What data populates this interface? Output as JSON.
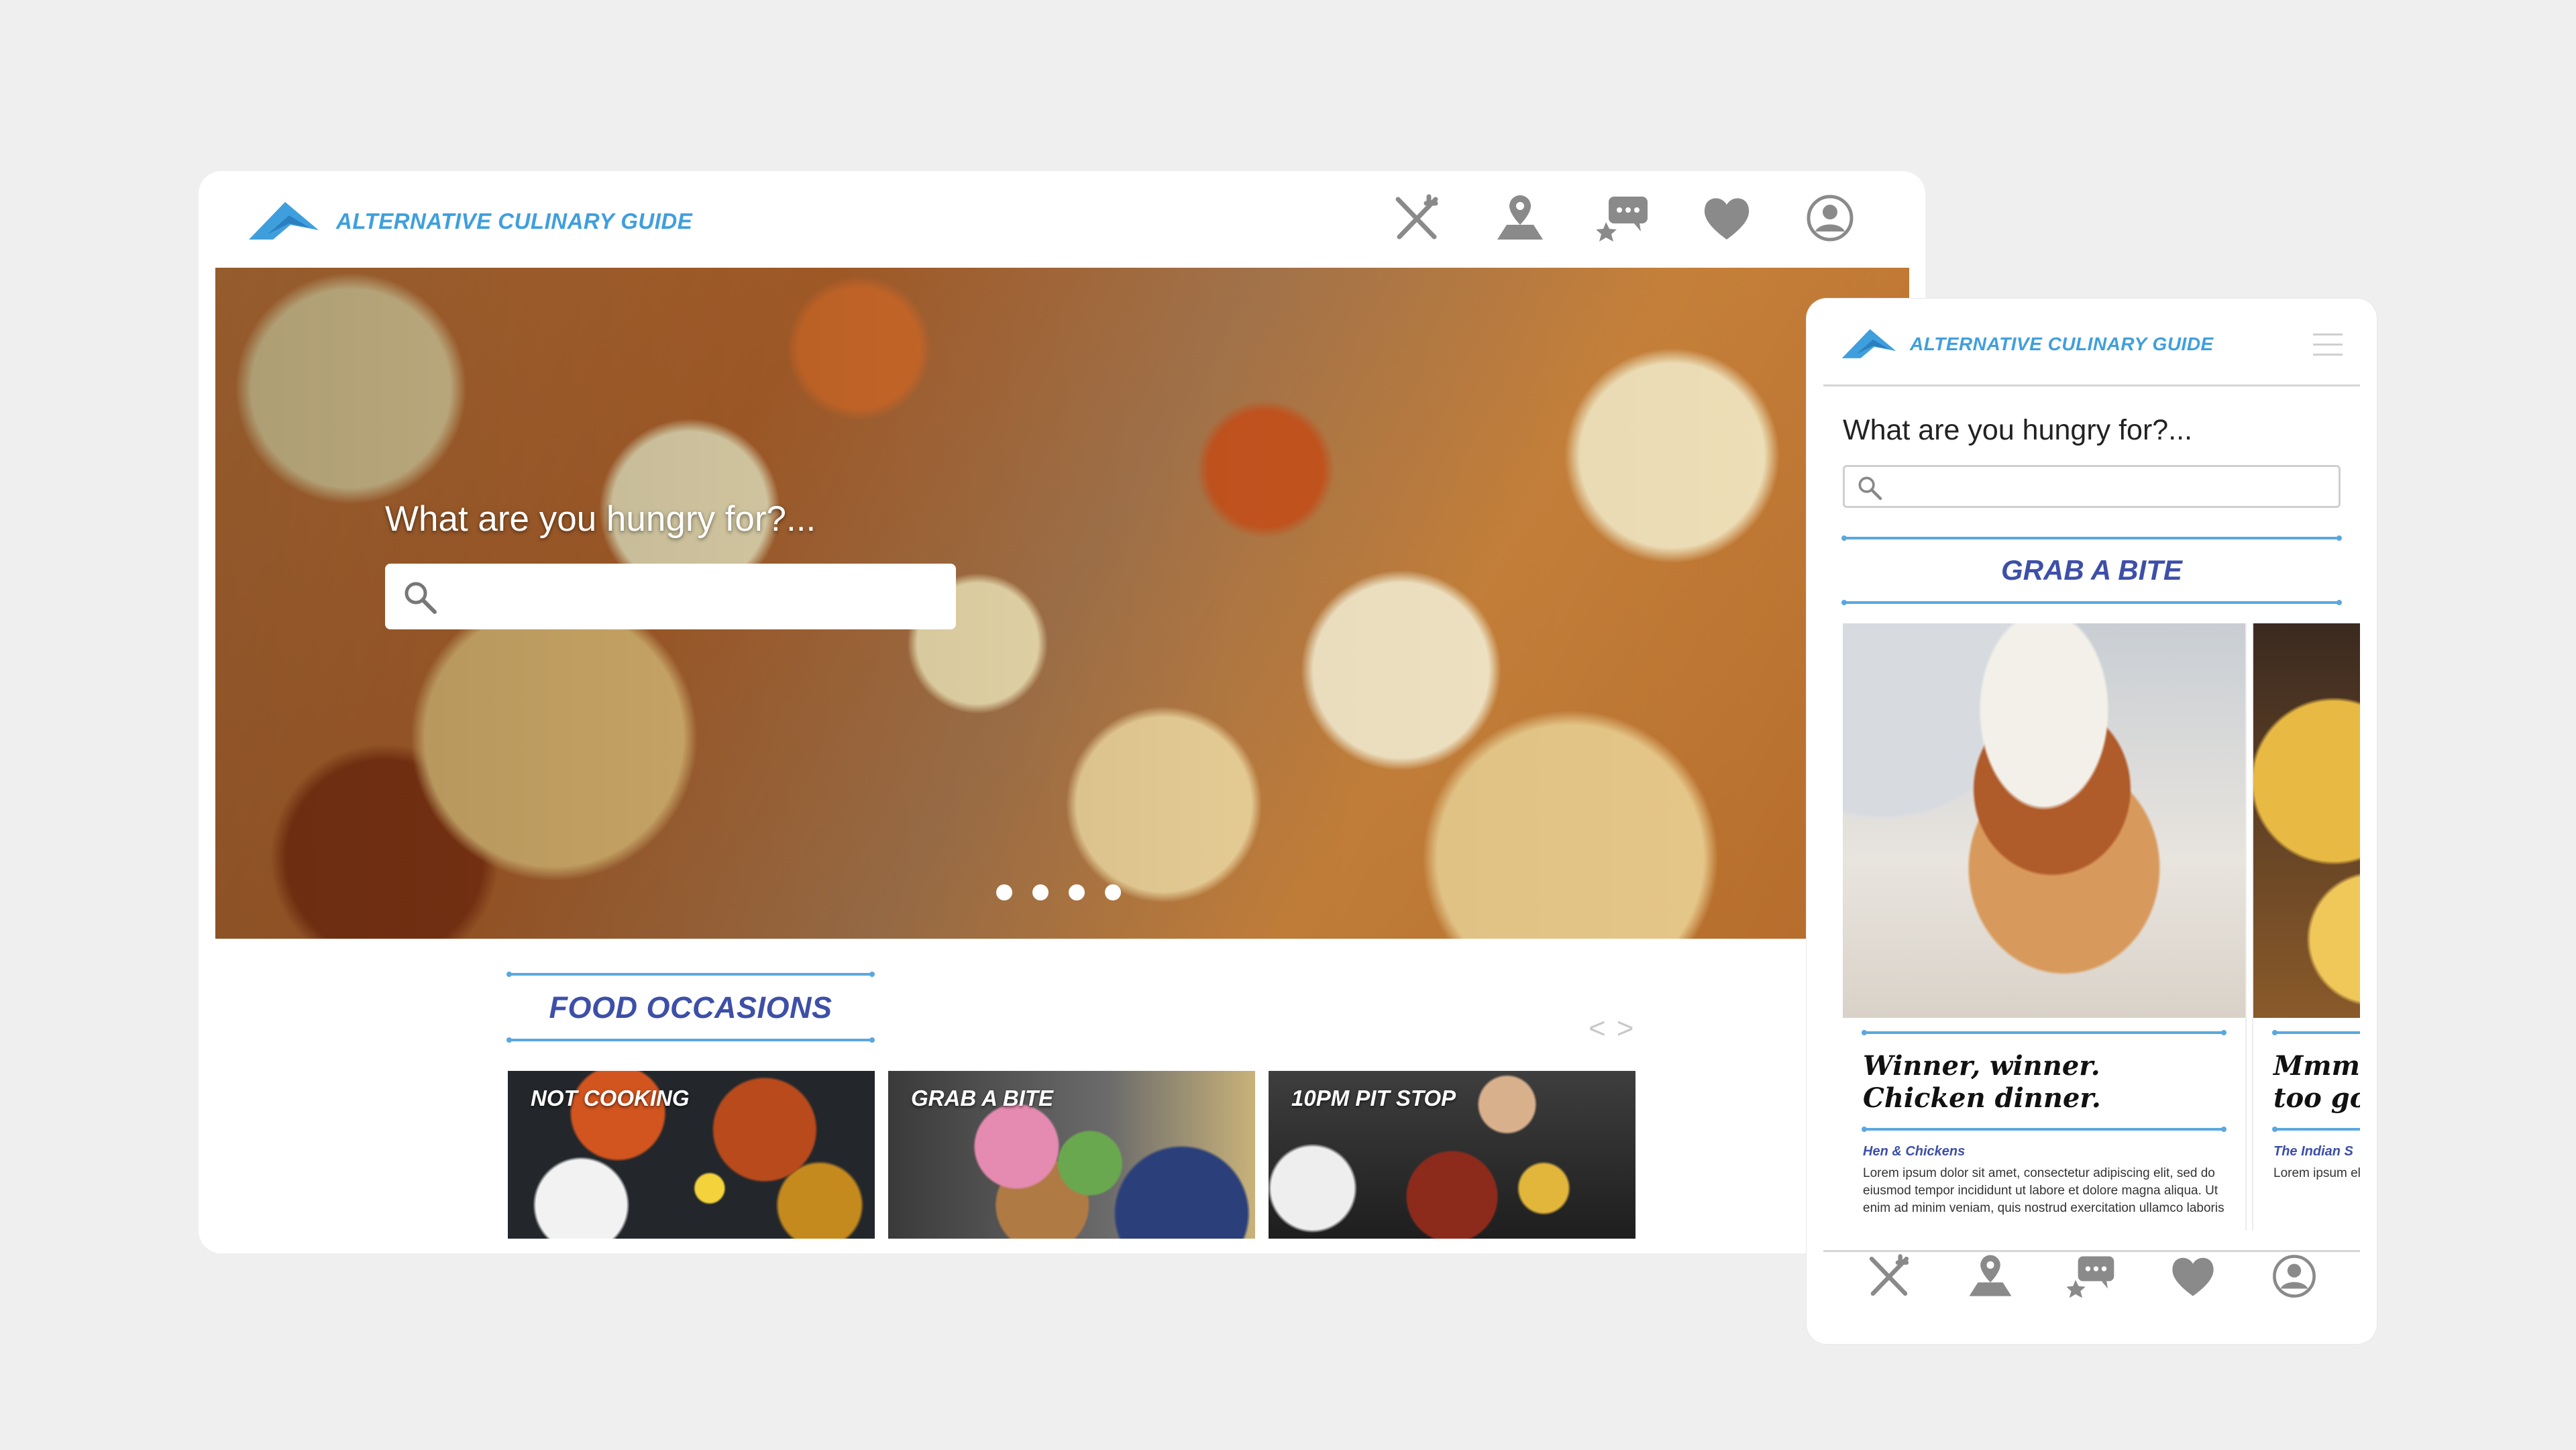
{
  "brand": {
    "name": "ALTERNATIVE CULINARY GUIDE",
    "color": "#3f9fdd",
    "accent": "#3d4fa8"
  },
  "nav": {
    "icons": [
      "utensils-icon",
      "map-pin-icon",
      "reviews-icon",
      "heart-icon",
      "user-icon"
    ],
    "icon_color": "#8a8a8a"
  },
  "hero": {
    "question": "What are you hungry for?...",
    "carousel_dots": 4
  },
  "occasions": {
    "title": "FOOD OCCASIONS",
    "prev": "<",
    "next": ">",
    "cards": [
      {
        "label": "NOT COOKING"
      },
      {
        "label": "GRAB A BITE"
      },
      {
        "label": "10PM PIT STOP"
      }
    ]
  },
  "mobile": {
    "question": "What are you hungry for?...",
    "section_title": "GRAB A BITE",
    "cards": [
      {
        "headline": "Winner, winner.\nChicken dinner.",
        "restaurant": "Hen & Chickens",
        "body": "Lorem ipsum dolor sit amet, consectetur adipiscing elit, sed do eiusmod tempor incididunt ut labore et dolore magna aliqua. Ut enim ad minim veniam, quis nostrud exercitation ullamco laboris"
      },
      {
        "headline": "Mmm\ntoo go",
        "restaurant": "The Indian S",
        "body": "Lorem ipsum elit, sed do dolore magn nostrud exer"
      }
    ]
  }
}
